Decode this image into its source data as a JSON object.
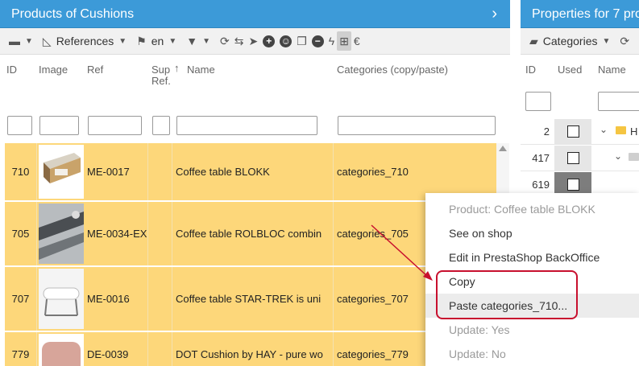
{
  "left_panel": {
    "title": "Products of Cushions",
    "toolbar": {
      "references_label": "References",
      "lang_label": "en"
    },
    "columns": {
      "id": "ID",
      "image": "Image",
      "ref": "Ref",
      "sup_ref_line1": "Sup",
      "sup_ref_line2": "Ref.",
      "sort_arrow": "↑",
      "name": "Name",
      "categories": "Categories (copy/paste)"
    },
    "rows": [
      {
        "id": "710",
        "ref": "ME-0017",
        "name": "Coffee table BLOKK",
        "categories": "categories_710"
      },
      {
        "id": "705",
        "ref": "ME-0034-EX",
        "name": "Coffee table ROLBLOC combin",
        "categories": "categories_705"
      },
      {
        "id": "707",
        "ref": "ME-0016",
        "name": "Coffee table STAR-TREK is uni",
        "categories": "categories_707"
      },
      {
        "id": "779",
        "ref": "DE-0039",
        "name": "DOT Cushion by HAY - pure wo",
        "categories": "categories_779"
      }
    ]
  },
  "right_panel": {
    "title": "Properties for 7 pro",
    "toolbar": {
      "categories_label": "Categories"
    },
    "columns": {
      "id": "ID",
      "used": "Used",
      "name": "Name"
    },
    "rows": [
      {
        "id": "2",
        "name": "H"
      },
      {
        "id": "417",
        "name": ""
      },
      {
        "id": "619",
        "name": ""
      }
    ]
  },
  "context_menu": {
    "items": [
      {
        "label": "Product: Coffee table BLOKK",
        "disabled": true
      },
      {
        "label": "See on shop",
        "disabled": false
      },
      {
        "label": "Edit in PrestaShop BackOffice",
        "disabled": false
      },
      {
        "label": "Copy",
        "disabled": false
      },
      {
        "label": "Paste categories_710...",
        "disabled": false
      },
      {
        "label": "Update: Yes",
        "disabled": true
      },
      {
        "label": "Update: No",
        "disabled": true
      }
    ]
  },
  "colors": {
    "header_blue": "#3c9ad8",
    "row_highlight": "#fdd77a",
    "annotation_red": "#c8102e"
  }
}
